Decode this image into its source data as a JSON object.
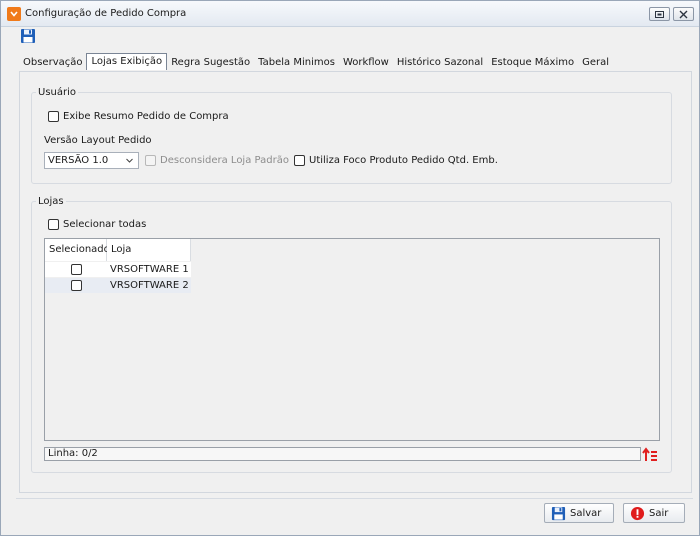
{
  "window": {
    "title": "Configuração de Pedido Compra"
  },
  "tabs": [
    {
      "label": "Observação"
    },
    {
      "label": "Lojas Exibição"
    },
    {
      "label": "Regra Sugestão"
    },
    {
      "label": "Tabela Minimos"
    },
    {
      "label": "Workflow"
    },
    {
      "label": "Histórico Sazonal"
    },
    {
      "label": "Estoque Máximo"
    },
    {
      "label": "Geral"
    }
  ],
  "usuario": {
    "title": "Usuário",
    "exibe_resumo": "Exibe Resumo Pedido de Compra",
    "versao_label": "Versão Layout Pedido",
    "versao_value": "VERSÃO 1.0",
    "desconsidera": "Desconsidera Loja Padrão",
    "utiliza_foco": "Utiliza Foco Produto Pedido Qtd. Emb."
  },
  "lojas": {
    "title": "Lojas",
    "selecionar_todas": "Selecionar todas",
    "columns": [
      "Selecionado",
      "Loja"
    ],
    "rows": [
      {
        "loja": "VRSOFTWARE 1"
      },
      {
        "loja": "VRSOFTWARE 2"
      }
    ],
    "status": "Linha: 0/2"
  },
  "buttons": {
    "salvar": "Salvar",
    "sair": "Sair"
  },
  "colors": {
    "accent": "#f07a1a",
    "sair_icon": "#e01b1b",
    "save_icon": "#1f5fb8"
  }
}
